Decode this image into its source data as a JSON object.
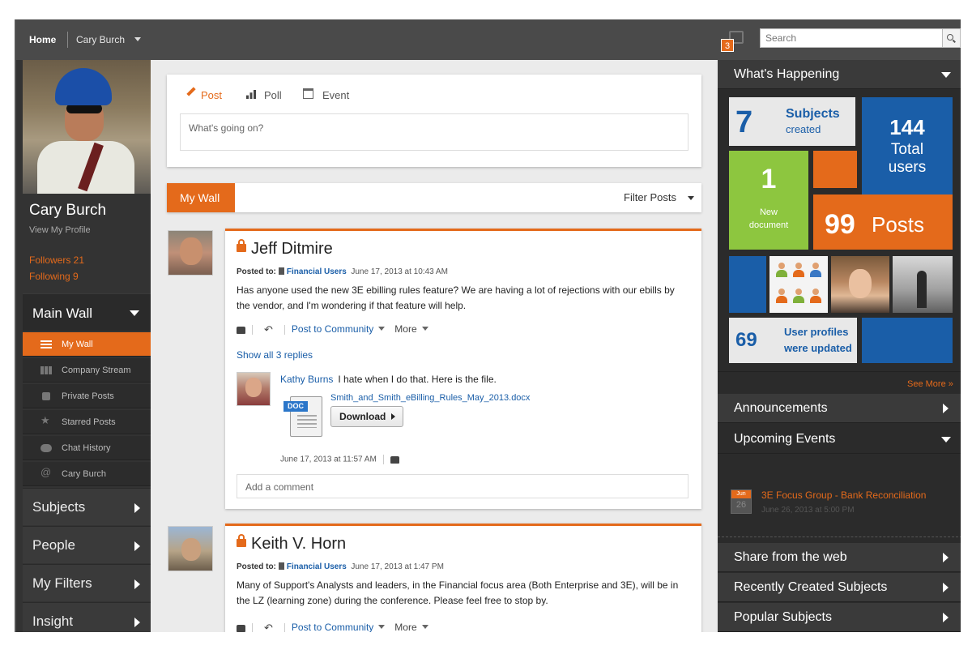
{
  "topbar": {
    "home": "Home",
    "user": "Cary Burch",
    "notifications": "3",
    "search_placeholder": "Search"
  },
  "profile": {
    "name": "Cary Burch",
    "view_profile": "View My Profile",
    "followers": "Followers  21",
    "following": "Following  9"
  },
  "sidebar": {
    "main_wall": "Main Wall",
    "sub_items": [
      {
        "label": "My Wall",
        "icon": "list-icon"
      },
      {
        "label": "Company Stream",
        "icon": "grid-icon"
      },
      {
        "label": "Private Posts",
        "icon": "lock-icon"
      },
      {
        "label": "Starred Posts",
        "icon": "star-icon"
      },
      {
        "label": "Chat History",
        "icon": "chat-icon"
      },
      {
        "label": "Cary Burch",
        "icon": "at-icon"
      }
    ],
    "sections": [
      "Subjects",
      "People",
      "My Filters",
      "Insight"
    ]
  },
  "composer": {
    "tabs": [
      "Post",
      "Poll",
      "Event"
    ],
    "placeholder": "What's going on?"
  },
  "wall": {
    "tab": "My Wall",
    "filter": "Filter Posts"
  },
  "posts": [
    {
      "author": "Jeff Ditmire",
      "posted_to_label": "Posted to:",
      "group": "Financial Users",
      "date": "June 17, 2013 at 10:43 AM",
      "body": "Has anyone used the new 3E ebilling rules feature? We are having a lot of rejections with our ebills by the vendor, and I'm wondering if that feature will help.",
      "post_to_community": "Post to Community",
      "more": "More",
      "show_replies": "Show all 3 replies",
      "reply": {
        "author": "Kathy Burns",
        "text": "I hate when I do that. Here is the file.",
        "file_type": "DOC",
        "file_name": "Smith_and_Smith_eBilling_Rules_May_2013.docx",
        "download": "Download",
        "date": "June 17, 2013 at 11:57 AM"
      },
      "comment_placeholder": "Add a comment"
    },
    {
      "author": "Keith V. Horn",
      "posted_to_label": "Posted to:",
      "group": "Financial Users",
      "date": "June 17, 2013 at 1:47 PM",
      "body": "Many of Support's Analysts and leaders, in the Financial focus area (Both Enterprise and 3E), will be in the LZ (learning zone) during the conference. Please feel free to stop by.",
      "post_to_community": "Post to Community",
      "more": "More"
    }
  ],
  "right": {
    "whats_happening": "What's Happening",
    "tiles": {
      "subjects": {
        "value": "7",
        "l1": "Subjects",
        "l2": "created"
      },
      "users": {
        "value": "144",
        "l1": "Total",
        "l2": "users"
      },
      "document": {
        "value": "1",
        "l1": "New",
        "l2": "document"
      },
      "posts": {
        "value": "99",
        "l1": "Posts"
      },
      "profiles": {
        "value": "69",
        "l1": "User profiles",
        "l2": "were updated"
      }
    },
    "see_more": "See More »",
    "announcements": "Announcements",
    "upcoming_events": "Upcoming Events",
    "event": {
      "month": "Jun",
      "day": "26",
      "title": "3E Focus Group - Bank Reconciliation",
      "date": "June 26, 2013 at 5:00 PM"
    },
    "share_web": "Share from the web",
    "recent_subjects": "Recently Created Subjects",
    "popular_subjects": "Popular Subjects"
  },
  "colors": {
    "accent": "#e46a1b",
    "blue": "#1a5ea8",
    "green": "#8dc63f",
    "dark": "#333333"
  }
}
